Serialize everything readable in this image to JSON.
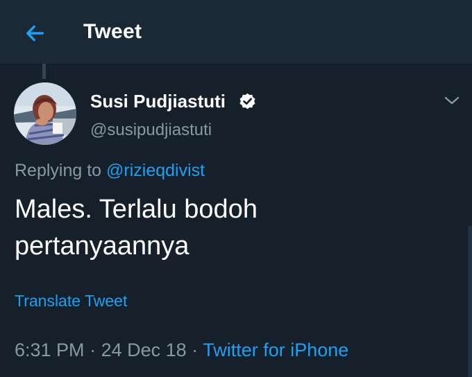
{
  "header": {
    "title": "Tweet",
    "back_icon": "arrow-left-icon",
    "accent_color": "#1da1f2"
  },
  "tweet": {
    "author_name": "Susi Pudjiastuti",
    "handle": "@susipudjiastuti",
    "verified": true,
    "verified_icon": "verified-badge-icon",
    "more_icon": "chevron-down-icon",
    "replying_prefix": "Replying to",
    "replying_to": "@rizieqdivist",
    "text_line1": "Males. Terlalu bodoh",
    "text_line2": "pertanyaannya",
    "translate_label": "Translate Tweet",
    "time": "6:31 PM",
    "separator": "·",
    "date": "24 Dec 18",
    "source": "Twitter for iPhone"
  },
  "colors": {
    "background": "#15202b",
    "header_background": "#1b2836",
    "secondary_text": "#8899a6",
    "link": "#1da1f2"
  }
}
